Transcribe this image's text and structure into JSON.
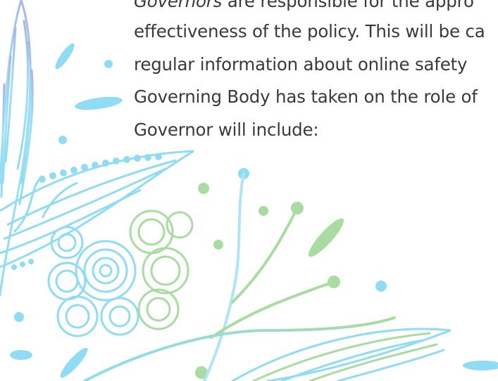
{
  "document": {
    "lines": [
      {
        "italic": "Governors",
        "text": " are responsible for the appro"
      },
      {
        "text": "effectiveness of the policy. This will be ca"
      },
      {
        "text": "regular information about online safety"
      },
      {
        "text": "Governing Body has taken on the role of"
      },
      {
        "text": "Governor will include:"
      }
    ]
  },
  "decoration": {
    "name": "floral-line-art",
    "colors": {
      "blue": "#8fdcf4",
      "light_blue": "#aee6f8",
      "green": "#a8dca0",
      "lavender": "#a9b6e6"
    }
  }
}
